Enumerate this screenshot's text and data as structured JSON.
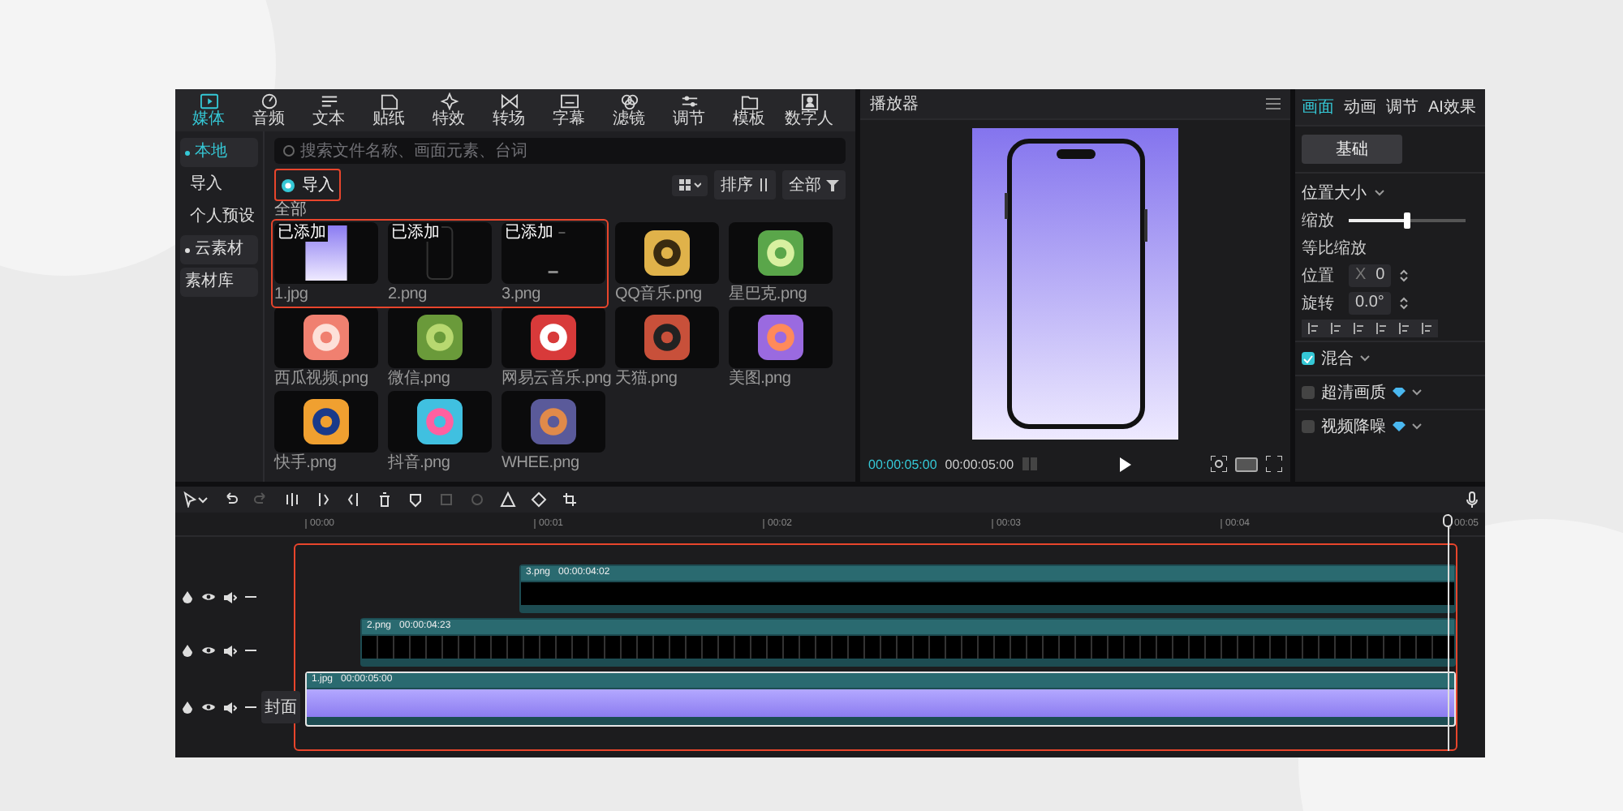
{
  "toolbar": {
    "tabs": [
      {
        "label": "媒体",
        "selected": true
      },
      {
        "label": "音频",
        "selected": false
      },
      {
        "label": "文本",
        "selected": false
      },
      {
        "label": "贴纸",
        "selected": false
      },
      {
        "label": "特效",
        "selected": false
      },
      {
        "label": "转场",
        "selected": false
      },
      {
        "label": "字幕",
        "selected": false
      },
      {
        "label": "滤镜",
        "selected": false
      },
      {
        "label": "调节",
        "selected": false
      },
      {
        "label": "模板",
        "selected": false
      },
      {
        "label": "数字人",
        "selected": false
      }
    ]
  },
  "media": {
    "sidebar": [
      {
        "label": "本地",
        "kind": "group",
        "selected": true
      },
      {
        "label": "导入",
        "kind": "sub",
        "selected": false
      },
      {
        "label": "个人预设",
        "kind": "sub",
        "selected": false
      },
      {
        "label": "云素材",
        "kind": "group",
        "selected": false
      },
      {
        "label": "素材库",
        "kind": "link",
        "selected": false
      }
    ],
    "search": {
      "placeholder": "搜索文件名称、画面元素、台词"
    },
    "import_button": {
      "label": "导入",
      "highlighted": true
    },
    "sort_button": "排序",
    "filter_button": "全部",
    "section_label": "全部",
    "added_items_highlighted": true,
    "items": [
      {
        "label": "1.jpg",
        "badge": "已添加"
      },
      {
        "label": "2.png",
        "badge": "已添加"
      },
      {
        "label": "3.png",
        "badge": "已添加"
      },
      {
        "label": "QQ音乐.png"
      },
      {
        "label": "星巴克.png"
      },
      {
        "label": "西瓜视频.png"
      },
      {
        "label": "微信.png"
      },
      {
        "label": "网易云音乐.png"
      },
      {
        "label": "天猫.png"
      },
      {
        "label": "美图.png"
      },
      {
        "label": "快手.png"
      },
      {
        "label": "抖音.png"
      },
      {
        "label": "WHEE.png"
      }
    ]
  },
  "player": {
    "title": "播放器",
    "current_time": "00:00:05:00",
    "total_time": "00:00:05:00"
  },
  "properties": {
    "tabs": [
      {
        "label": "画面",
        "selected": true
      },
      {
        "label": "动画",
        "selected": false
      },
      {
        "label": "调节",
        "selected": false
      },
      {
        "label": "AI效果",
        "selected": false
      }
    ],
    "subtabs": [
      {
        "label": "基础",
        "selected": true
      }
    ],
    "section": "位置大小",
    "scale": {
      "label": "缩放",
      "level": 0.5
    },
    "proportional_label": "等比缩放",
    "position": {
      "label": "位置",
      "axis": "X",
      "value": "0"
    },
    "rotation": {
      "label": "旋转",
      "value": "0.0°"
    },
    "options": [
      {
        "label": "混合",
        "checked": true,
        "premium": false
      },
      {
        "label": "超清画质",
        "checked": false,
        "premium": true
      },
      {
        "label": "视频降噪",
        "checked": false,
        "premium": true
      }
    ]
  },
  "timeline": {
    "tools": [
      {
        "kind": "select",
        "disabled": false
      },
      {
        "kind": "undo",
        "disabled": false
      },
      {
        "kind": "redo",
        "disabled": true
      },
      {
        "kind": "split",
        "disabled": false
      },
      {
        "kind": "split_left",
        "disabled": false
      },
      {
        "kind": "split_right",
        "disabled": false
      },
      {
        "kind": "delete",
        "disabled": false
      },
      {
        "kind": "marker",
        "disabled": false
      },
      {
        "kind": "freeze",
        "disabled": true
      },
      {
        "kind": "reverse",
        "disabled": true
      },
      {
        "kind": "mirror",
        "disabled": false
      },
      {
        "kind": "rotate",
        "disabled": false
      },
      {
        "kind": "crop",
        "disabled": false
      }
    ],
    "ruler": [
      "00:00",
      "00:01",
      "00:02",
      "00:03",
      "00:04",
      "00:05"
    ],
    "highlighted": true,
    "tracks": [
      {
        "kind": "overlay",
        "clip_name": "3.png",
        "clip_duration": "00:00:04:02",
        "selected": false
      },
      {
        "kind": "overlay",
        "clip_name": "2.png",
        "clip_duration": "00:00:04:23",
        "selected": false
      },
      {
        "kind": "main",
        "clip_name": "1.jpg",
        "clip_duration": "00:00:05:00",
        "selected": true,
        "cover_label": "封面"
      }
    ]
  }
}
